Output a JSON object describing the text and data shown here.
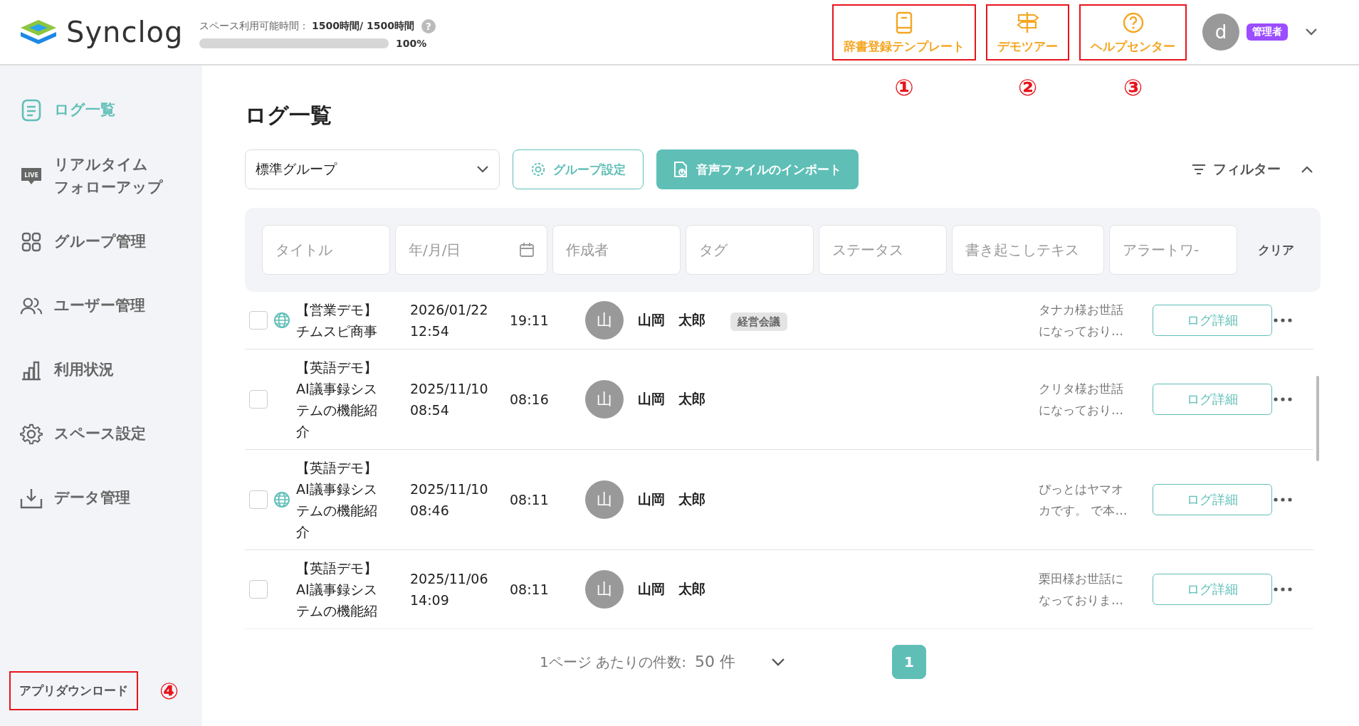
{
  "header": {
    "logo_text": "Synclog",
    "usage": {
      "label": "スペース利用可能時間：",
      "value": "1500時間/ 1500時間",
      "level": 1,
      "percent": "100%",
      "help": "?"
    },
    "nav_buttons": [
      {
        "kind": "book",
        "label": "辞書登録テンプレート",
        "marker": "①"
      },
      {
        "kind": "signpost",
        "label": "デモツアー",
        "marker": "②"
      },
      {
        "kind": "help",
        "label": "ヘルプセンター",
        "marker": "③"
      }
    ],
    "user": {
      "avatar": "d",
      "role": "管理者"
    }
  },
  "sidebar": {
    "items": [
      {
        "kind": "list",
        "label_lines": [
          "ログ一覧"
        ],
        "selected": true
      },
      {
        "kind": "live",
        "icon_text": "LIVE",
        "label_lines": [
          "リアルタイム",
          "フォローアップ"
        ],
        "selected": false
      },
      {
        "kind": "grid",
        "label_lines": [
          "グループ管理"
        ],
        "selected": false
      },
      {
        "kind": "users",
        "label_lines": [
          "ユーザー管理"
        ],
        "selected": false
      },
      {
        "kind": "chart",
        "label_lines": [
          "利用状況"
        ],
        "selected": false
      },
      {
        "kind": "gear",
        "label_lines": [
          "スペース設定"
        ],
        "selected": false
      },
      {
        "kind": "download",
        "label_lines": [
          "データ管理"
        ],
        "selected": false
      }
    ],
    "footer": {
      "label": "アプリダウンロード",
      "marker": "④"
    }
  },
  "page_title": "ログ一覧",
  "toolbar": {
    "group_select": "標準グループ",
    "group_settings": "グループ設定",
    "import": "音声ファイルのインポート",
    "filter_toggle": "フィルター",
    "filter_expanded": true
  },
  "filters": [
    {
      "kind": "text",
      "placeholder": "タイトル"
    },
    {
      "kind": "date",
      "placeholder": "年/月/日"
    },
    {
      "kind": "text",
      "placeholder": "作成者"
    },
    {
      "kind": "text",
      "placeholder": "タグ"
    },
    {
      "kind": "text",
      "placeholder": "ステータス"
    },
    {
      "kind": "wide",
      "placeholder": "書き起こしテキス"
    },
    {
      "kind": "text",
      "placeholder": "アラートワ-"
    }
  ],
  "filter_clear": "クリア",
  "rows": [
    {
      "checked": false,
      "shared": true,
      "title_lines": [
        "【営業デモ】",
        "チムスピ商事"
      ],
      "date": "2026/01/22",
      "time": "12:54",
      "duration": "19:11",
      "avatar": "山",
      "author": "山岡　太郎",
      "tag": "経営会議",
      "summary_lines": [
        "タナカ様お世話",
        "になっており…"
      ],
      "button": "ログ詳細"
    },
    {
      "checked": false,
      "shared": false,
      "title_lines": [
        "【英語デモ】",
        "AI議事録シス",
        "テムの機能紹",
        "介"
      ],
      "date": "2025/11/10",
      "time": "08:54",
      "duration": "08:16",
      "avatar": "山",
      "author": "山岡　太郎",
      "summary_lines": [
        "クリタ様お世話",
        "になっており…"
      ],
      "button": "ログ詳細"
    },
    {
      "checked": false,
      "shared": true,
      "title_lines": [
        "【英語デモ】",
        "AI議事録シス",
        "テムの機能紹",
        "介"
      ],
      "date": "2025/11/10",
      "time": "08:46",
      "duration": "08:11",
      "avatar": "山",
      "author": "山岡　太郎",
      "summary_lines": [
        "ぴっとはヤマオ",
        "カです。 で本…"
      ],
      "button": "ログ詳細"
    },
    {
      "checked": false,
      "shared": false,
      "title_lines": [
        "【英語デモ】",
        "AI議事録シス",
        "テムの機能紹"
      ],
      "date": "2025/11/06",
      "time": "14:09",
      "duration": "08:11",
      "avatar": "山",
      "author": "山岡　太郎",
      "summary_lines": [
        "栗田様お世話に",
        "なっておりま…"
      ],
      "button": "ログ詳細"
    }
  ],
  "pagination": {
    "per_page_label": "1ページ あたりの件数:",
    "per_page": "50 件",
    "pages": [
      {
        "label": "1",
        "selected": true
      }
    ]
  }
}
